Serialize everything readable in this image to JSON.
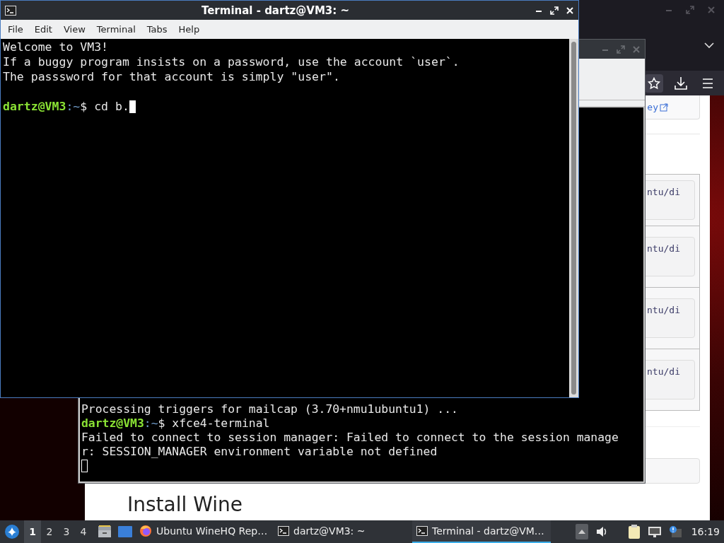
{
  "terminal": {
    "title": "Terminal - dartz@VM3: ~",
    "focused": true,
    "menu": [
      "File",
      "Edit",
      "View",
      "Terminal",
      "Tabs",
      "Help"
    ],
    "lines": [
      {
        "kind": "text",
        "text": "Welcome to VM3!"
      },
      {
        "kind": "text",
        "text": "If a buggy program insists on a password, use the account `user`."
      },
      {
        "kind": "text",
        "text": "The passsword for that account is simply \"user\"."
      },
      {
        "kind": "blank"
      },
      {
        "kind": "prompt",
        "user": "dartz@VM3",
        "path": ":~",
        "command": "$ cd b.",
        "cursor": true
      }
    ]
  },
  "background_terminal": {
    "focused": false,
    "lines": [
      {
        "kind": "text",
        "text": "Processing triggers for mailcap (3.70+nmu1ubuntu1) ..."
      },
      {
        "kind": "prompt",
        "user": "dartz@VM3",
        "path": ":~",
        "command": "$ xfce4-terminal",
        "cursor": false
      },
      {
        "kind": "text",
        "text": "Failed to connect to session manager: Failed to connect to the session manage"
      },
      {
        "kind": "text",
        "text": "r: SESSION_MANAGER environment variable not defined"
      },
      {
        "kind": "cursor"
      }
    ]
  },
  "browser": {
    "link_fragment": "ey",
    "code_fragments": [
      "ntu/di",
      "ntu/di",
      "ntu/di",
      "ntu/di"
    ],
    "heading": "Install Wine"
  },
  "taskbar": {
    "workspaces": [
      {
        "label": "1",
        "selected": true
      },
      {
        "label": "2",
        "selected": false
      },
      {
        "label": "3",
        "selected": false
      },
      {
        "label": "4",
        "selected": false
      }
    ],
    "tasks": [
      {
        "label": "Ubuntu WineHQ Rep…",
        "kind": "browser",
        "selected": false
      },
      {
        "label": "dartz@VM3: ~",
        "kind": "terminal",
        "selected": false
      },
      {
        "label": "Terminal - dartz@VM…",
        "kind": "terminal",
        "selected": true
      }
    ],
    "clock": "16:19"
  }
}
